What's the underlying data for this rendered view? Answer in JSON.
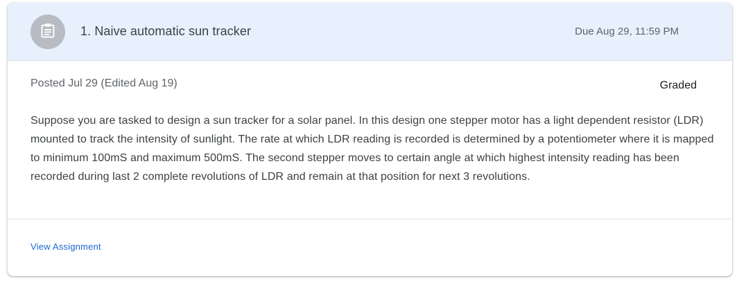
{
  "assignment": {
    "title": "1. Naive automatic sun tracker",
    "due": "Due Aug 29, 11:59 PM",
    "icon": "assignment-icon",
    "posted": "Posted Jul 29 (Edited Aug 19)",
    "status": "Graded",
    "description": "Suppose you are tasked to design a sun tracker for a solar panel. In this design one stepper motor has a light dependent resistor (LDR) mounted to track the intensity of sunlight. The rate at which LDR reading is recorded is determined by a potentiometer where it is mapped to minimum 100mS and maximum 500mS. The second stepper moves to certain angle at which highest intensity reading has been recorded during last 2 complete revolutions of LDR and remain at that position for next 3 revolutions.",
    "view_link": "View Assignment"
  },
  "colors": {
    "header_bg": "#e8f0fe",
    "avatar_bg": "#b8bcc2",
    "link": "#1967d2"
  }
}
